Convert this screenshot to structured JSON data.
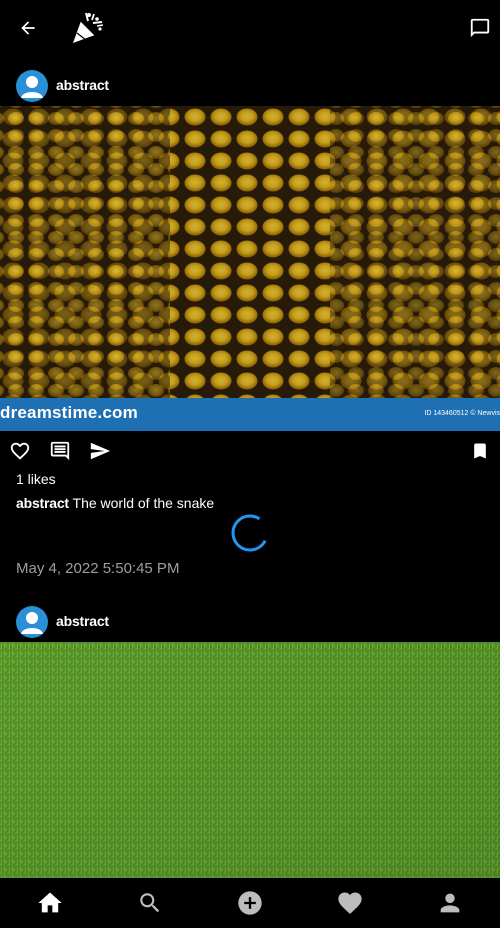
{
  "appbar": {
    "back_icon": "arrow-back-icon",
    "logo_icon": "party-popper-logo",
    "messages_icon": "chat-bubble-icon"
  },
  "posts": [
    {
      "username": "abstract",
      "image": "snake-skin-texture",
      "watermark_left": "dreamstime.com",
      "watermark_right": "ID 143460512 © Newvis",
      "likes": "1 likes",
      "caption_user": "abstract",
      "caption_text": "The world of the snake",
      "timestamp": "May 4, 2022 5:50:45 PM"
    },
    {
      "username": "abstract",
      "image": "grass-texture"
    }
  ],
  "actions": {
    "like_icon": "heart-outline-icon",
    "comment_icon": "comment-icon",
    "share_icon": "send-icon",
    "save_icon": "bookmark-icon"
  },
  "bottom_nav": [
    {
      "icon": "home-icon",
      "active": true
    },
    {
      "icon": "search-icon"
    },
    {
      "icon": "add-circle-icon"
    },
    {
      "icon": "heart-icon"
    },
    {
      "icon": "person-icon"
    }
  ],
  "colors": {
    "background": "#000000",
    "accent": "#2196f3",
    "avatar": "#2a8fd4",
    "timestamp": "#9e9e9e",
    "watermark_bar": "#1f6fb3"
  }
}
